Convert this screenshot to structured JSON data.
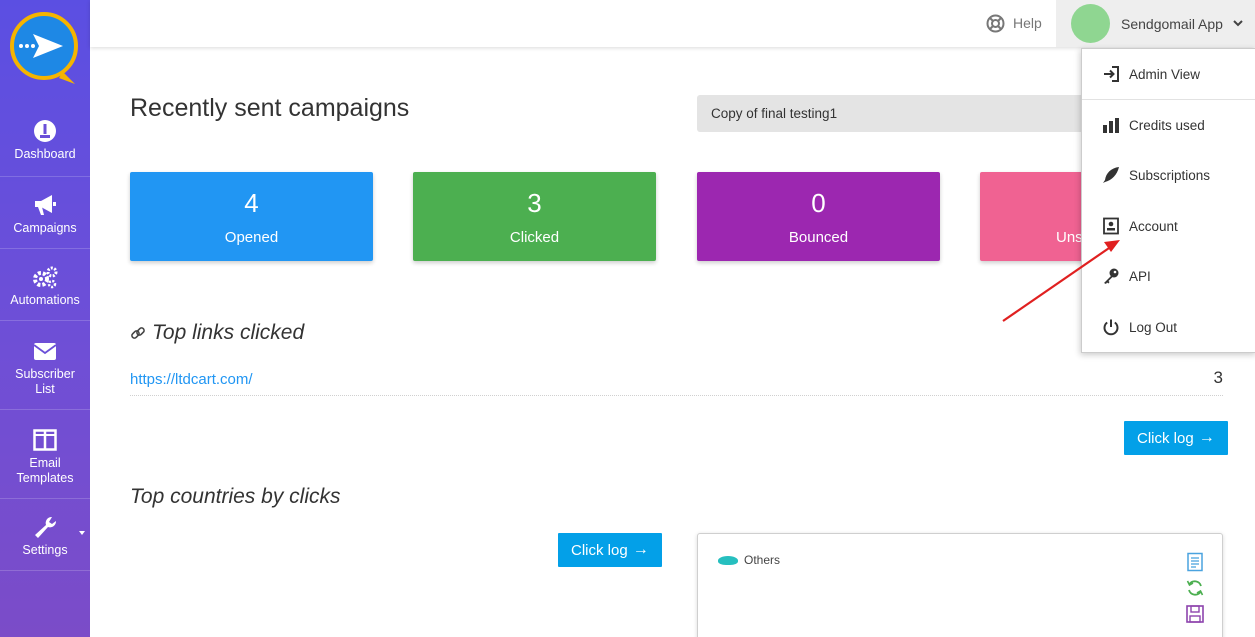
{
  "sidebar": {
    "items": [
      {
        "label": "Dashboard",
        "icon": "dashboard-gauge-icon"
      },
      {
        "label": "Campaigns",
        "icon": "megaphone-icon"
      },
      {
        "label": "Automations",
        "icon": "gears-icon"
      },
      {
        "label": "Subscriber List",
        "icon": "envelope-icon"
      },
      {
        "label": "Email Templates",
        "icon": "columns-layout-icon"
      },
      {
        "label": "Settings",
        "icon": "wrench-icon"
      }
    ]
  },
  "topbar": {
    "help_label": "Help",
    "user_name": "Sendgomail App"
  },
  "main": {
    "title": "Recently sent campaigns",
    "campaign_selected": "Copy of final testing1",
    "stats": [
      {
        "value": "4",
        "label": "Opened",
        "color": "#2196f3"
      },
      {
        "value": "3",
        "label": "Clicked",
        "color": "#4caf50"
      },
      {
        "value": "0",
        "label": "Bounced",
        "color": "#9c27b0"
      },
      {
        "value": "",
        "label": "Uns",
        "color": "#f06292"
      }
    ],
    "top_links_title": "Top links clicked",
    "links": [
      {
        "url": "https://ltdcart.com/",
        "count": "3"
      }
    ],
    "click_log_label": "Click log",
    "top_countries_title": "Top countries by clicks",
    "chart_legend": "Others"
  },
  "dropdown": {
    "items": [
      {
        "label": "Admin View",
        "icon": "sign-in-icon"
      },
      {
        "label": "Credits used",
        "icon": "bar-chart-icon"
      },
      {
        "label": "Subscriptions",
        "icon": "feather-icon"
      },
      {
        "label": "Account",
        "icon": "id-card-icon"
      },
      {
        "label": "API",
        "icon": "key-icon"
      },
      {
        "label": "Log Out",
        "icon": "power-icon"
      }
    ]
  }
}
